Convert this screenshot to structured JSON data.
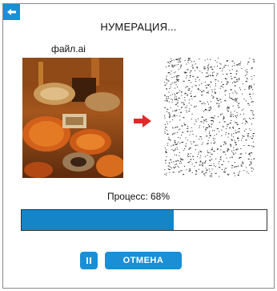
{
  "dialog": {
    "title": "НУМЕРАЦИЯ...",
    "file_name": "файл.ai",
    "progress_text": "Процесс: 68%",
    "progress_value": 0.62,
    "cancel_label": "ОТМЕНА",
    "back_icon": "back-arrow-icon",
    "pause_icon": "pause-icon",
    "arrow_icon": "right-arrow-icon",
    "colors": {
      "accent": "#1a8fd6",
      "progress_fill": "#1585c8",
      "arrow": "#e02a2a"
    }
  }
}
